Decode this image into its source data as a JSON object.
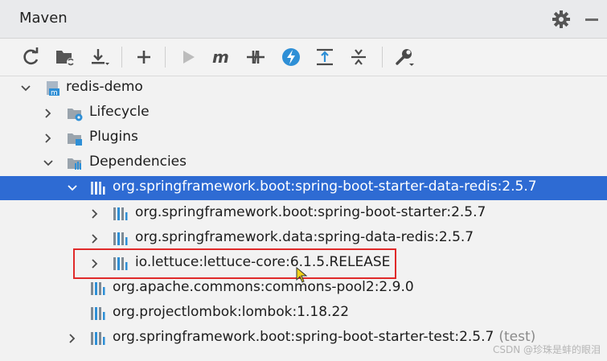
{
  "panel": {
    "title": "Maven"
  },
  "toolbar": {
    "buttons": [
      {
        "icon": "reload-icon"
      },
      {
        "icon": "generate-sources-icon"
      },
      {
        "icon": "download-icon"
      },
      {
        "icon": "add-icon"
      },
      {
        "icon": "run-icon"
      },
      {
        "icon": "execute-goal-icon"
      },
      {
        "icon": "toggle-offline-icon"
      },
      {
        "icon": "skip-tests-icon"
      },
      {
        "icon": "show-dependencies-icon"
      },
      {
        "icon": "collapse-all-icon"
      },
      {
        "icon": "settings-wrench-icon"
      }
    ]
  },
  "tree": {
    "project": "redis-demo",
    "lifecycle": "Lifecycle",
    "plugins": "Plugins",
    "dependencies": "Dependencies",
    "dep_redis": "org.springframework.boot:spring-boot-starter-data-redis:2.5.7",
    "dep_starter": "org.springframework.boot:spring-boot-starter:2.5.7",
    "dep_data_redis": "org.springframework.data:spring-data-redis:2.5.7",
    "dep_lettuce": "io.lettuce:lettuce-core:6.1.5.RELEASE",
    "dep_pool": "org.apache.commons:commons-pool2:2.9.0",
    "dep_lombok": "org.projectlombok:lombok:1.18.22",
    "dep_test": "org.springframework.boot:spring-boot-starter-test:2.5.7",
    "dep_test_scope": "(test)"
  },
  "colors": {
    "selection": "#2e6bd3",
    "highlight_box": "#e02a2a",
    "accent_blue": "#2e8fd6"
  },
  "watermark": "CSDN @珍珠是蚌的眼泪"
}
